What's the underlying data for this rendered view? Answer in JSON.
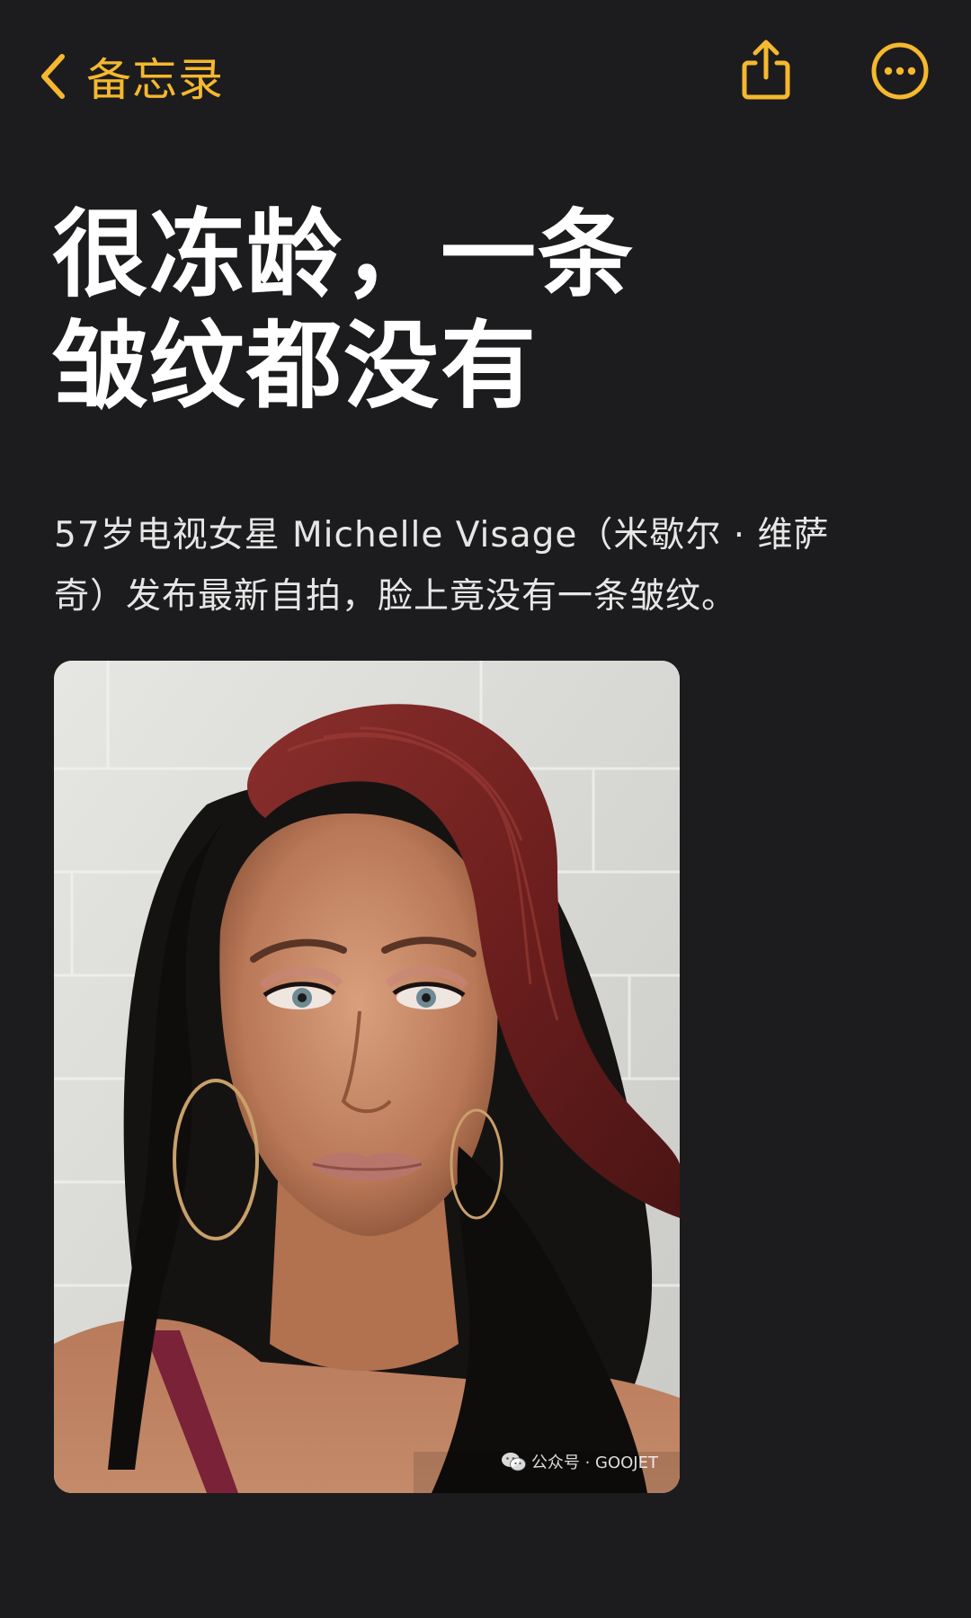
{
  "nav": {
    "back_label": "备忘录",
    "back_icon": "chevron-left-icon",
    "share_icon": "share-icon",
    "more_icon": "ellipsis-circle-icon",
    "accent_color": "#f5b82e"
  },
  "note": {
    "title_line1": "很冻龄，一条",
    "title_line2": "皱纹都没有",
    "body_line1": "57岁电视女星 Michelle Visage（米歇尔 · 维萨",
    "body_line2": "奇）发布最新自拍，脸上竟没有一条皱纹。"
  },
  "photo": {
    "watermark": "公众号 · GOOJET"
  }
}
